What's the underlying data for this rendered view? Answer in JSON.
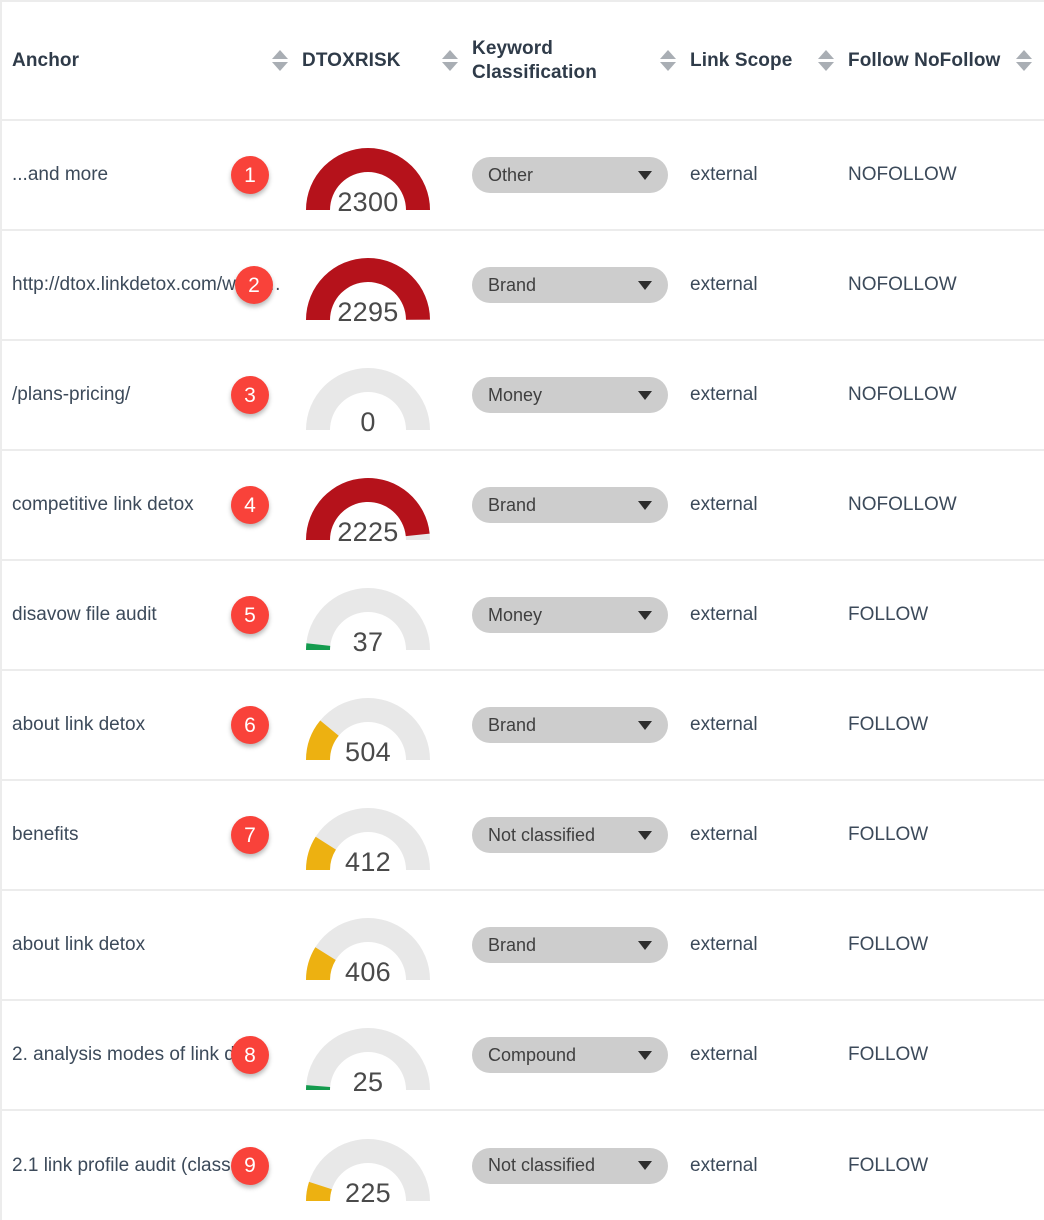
{
  "table": {
    "columns": [
      {
        "label": "Anchor",
        "sort_icon": "sort-arrows-icon"
      },
      {
        "label": "DTOXRISK",
        "sort_icon": "sort-arrows-icon"
      },
      {
        "label": "Keyword Classification",
        "sort_icon": "sort-arrows-icon"
      },
      {
        "label": "Link Scope",
        "sort_icon": "sort-arrows-icon"
      },
      {
        "label": "Follow NoFollow",
        "sort_icon": "sort-arrows-icon"
      }
    ],
    "gauge": {
      "max": 2300,
      "track_color": "#e8e8e8",
      "color_red": "#b5121b",
      "color_yellow": "#edb111",
      "color_green": "#149b4e"
    },
    "badge_color": "#f9423a",
    "rows": [
      {
        "badge": "1",
        "anchor": "...and more",
        "dtoxrisk": "2300",
        "gauge_pct": 100,
        "gauge_color": "red",
        "keyword_classification": "Other",
        "link_scope": "external",
        "follow_nofollow": "NOFOLLOW"
      },
      {
        "badge": "2",
        "anchor": "http://dtox.linkdetox.com/wp-c…",
        "dtoxrisk": "2295",
        "gauge_pct": 99.8,
        "gauge_color": "red",
        "keyword_classification": "Brand",
        "link_scope": "external",
        "follow_nofollow": "NOFOLLOW"
      },
      {
        "badge": "3",
        "anchor": "/plans-pricing/",
        "dtoxrisk": "0",
        "gauge_pct": 0,
        "gauge_color": "green",
        "keyword_classification": "Money",
        "link_scope": "external",
        "follow_nofollow": "NOFOLLOW"
      },
      {
        "badge": "4",
        "anchor": "competitive link detox",
        "dtoxrisk": "2225",
        "gauge_pct": 96.7,
        "gauge_color": "red",
        "keyword_classification": "Brand",
        "link_scope": "external",
        "follow_nofollow": "NOFOLLOW"
      },
      {
        "badge": "5",
        "anchor": "disavow file audit",
        "dtoxrisk": "37",
        "gauge_pct": 3.5,
        "gauge_color": "green",
        "keyword_classification": "Money",
        "link_scope": "external",
        "follow_nofollow": "FOLLOW"
      },
      {
        "badge": "6",
        "anchor": "about link detox",
        "dtoxrisk": "504",
        "gauge_pct": 22,
        "gauge_color": "yellow",
        "keyword_classification": "Brand",
        "link_scope": "external",
        "follow_nofollow": "FOLLOW"
      },
      {
        "badge": "7",
        "anchor": "benefits",
        "dtoxrisk": "412",
        "gauge_pct": 18,
        "gauge_color": "yellow",
        "keyword_classification": "Not classified",
        "link_scope": "external",
        "follow_nofollow": "FOLLOW"
      },
      {
        "badge": "",
        "anchor": "about link detox",
        "dtoxrisk": "406",
        "gauge_pct": 17.7,
        "gauge_color": "yellow",
        "keyword_classification": "Brand",
        "link_scope": "external",
        "follow_nofollow": "FOLLOW"
      },
      {
        "badge": "8",
        "anchor": "2. analysis modes of link d…",
        "dtoxrisk": "25",
        "gauge_pct": 2.5,
        "gauge_color": "green",
        "keyword_classification": "Compound",
        "link_scope": "external",
        "follow_nofollow": "FOLLOW"
      },
      {
        "badge": "9",
        "anchor": "2.1 link profile audit (class…",
        "dtoxrisk": "225",
        "gauge_pct": 10,
        "gauge_color": "yellow",
        "keyword_classification": "Not classified",
        "link_scope": "external",
        "follow_nofollow": "FOLLOW"
      }
    ]
  }
}
